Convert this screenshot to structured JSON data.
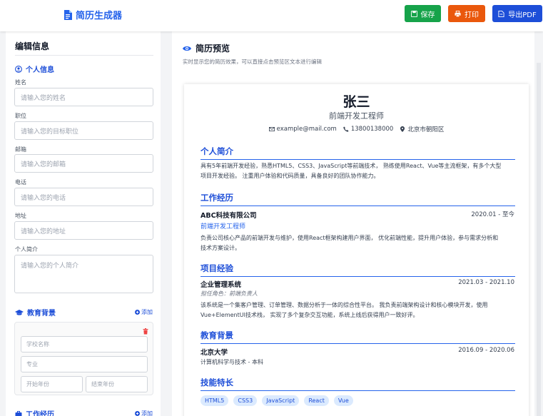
{
  "header": {
    "app_title": "简历生成器",
    "save_label": "保存",
    "print_label": "打印",
    "export_label": "导出PDF"
  },
  "editor": {
    "title": "编辑信息",
    "personal_section": "个人信息",
    "fields": [
      {
        "label": "姓名",
        "placeholder": "请输入您的姓名"
      },
      {
        "label": "职位",
        "placeholder": "请输入您的目标职位"
      },
      {
        "label": "邮箱",
        "placeholder": "请输入您的邮箱"
      },
      {
        "label": "电话",
        "placeholder": "请输入您的电话"
      },
      {
        "label": "地址",
        "placeholder": "请输入您的地址"
      },
      {
        "label": "个人简介",
        "placeholder": "请输入您的个人简介"
      }
    ],
    "education_section": "教育背景",
    "add_label": "添加",
    "education_inputs": {
      "school": "学校名称",
      "major": "专业",
      "start": "开始年份",
      "end": "结束年份"
    },
    "work_section": "工作经历"
  },
  "preview": {
    "title": "简历预览",
    "subtitle": "实时显示您的简历效果，可以直接点击预览区文本进行编辑",
    "name": "张三",
    "role": "前端开发工程师",
    "email": "example@mail.com",
    "phone": "13800138000",
    "address": "北京市朝阳区",
    "summary_title": "个人简介",
    "summary_l1": "具有5年前端开发经验，熟悉HTML5、CSS3、JavaScript等前端技术， 熟练使用React、Vue等主流框架，有多个大型",
    "summary_l2": "项目开发经验。 注重用户体验和代码质量，具备良好的团队协作能力。",
    "work_title": "工作经历",
    "work_company": "ABC科技有限公司",
    "work_date": "2020.01 - 至今",
    "work_position": "前端开发工程师",
    "work_l1": "负责公司核心产品的前端开发与维护，使用React框架构建用户界面， 优化前端性能，提升用户体验，参与需求分析和",
    "work_l2": "技术方案设计。",
    "project_title": "项目经验",
    "project_name": "企业管理系统",
    "project_date": "2021.03 - 2021.10",
    "project_role": "担任角色：前端负责人",
    "project_l1": "该系统是一个集客户管理、订单管理、数据分析于一体的综合性平台。 我负责前端架构设计和核心模块开发，使用",
    "project_l2": "Vue+ElementUI技术栈， 实现了多个复杂交互功能，系统上线后获得用户一致好评。",
    "edu_title": "教育背景",
    "edu_school": "北京大学",
    "edu_date": "2016.09 - 2020.06",
    "edu_major": "计算机科学与技术 - 本科",
    "skills_title": "技能特长",
    "skills": [
      "HTML5",
      "CSS3",
      "JavaScript",
      "React",
      "Vue"
    ]
  },
  "colors": {
    "accent": "#2563eb",
    "save": "#16a34a",
    "print": "#ea580c",
    "pdf": "#1d4ed8"
  }
}
